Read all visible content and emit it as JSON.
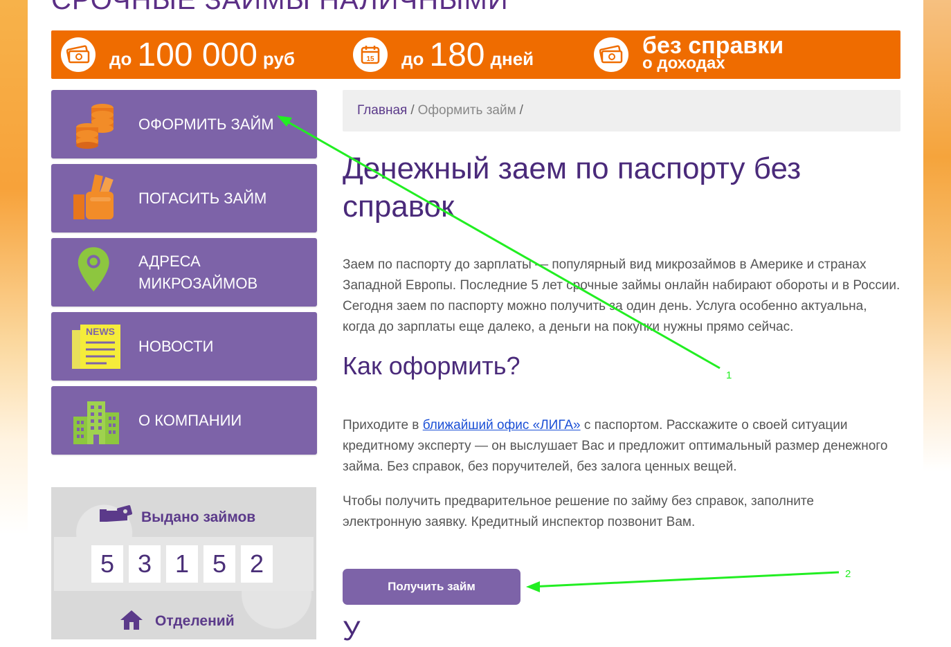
{
  "site": {
    "title": "СРОЧНЫЕ ЗАЙМЫ НАЛИЧНЫМИ"
  },
  "topbar": {
    "amount": {
      "icon": "money-icon",
      "pre": "до",
      "big": "100 000",
      "post": "руб"
    },
    "term": {
      "icon": "calendar-icon",
      "calendar_day": "15",
      "pre": "до",
      "big": "180",
      "post": "дней"
    },
    "nodocs": {
      "icon": "money-icon",
      "line1": "без справки",
      "line2": "о доходах"
    }
  },
  "menu": {
    "items": [
      {
        "label": "ОФОРМИТЬ ЗАЙМ",
        "icon": "coins-icon"
      },
      {
        "label": "ПОГАСИТЬ ЗАЙМ",
        "icon": "hand-money-icon"
      },
      {
        "label": "АДРЕСА МИКРОЗАЙМОВ",
        "icon": "map-pin-icon"
      },
      {
        "label": "НОВОСТИ",
        "icon": "news-icon",
        "icon_text": "NEWS"
      },
      {
        "label": "О КОМПАНИИ",
        "icon": "buildings-icon"
      }
    ]
  },
  "counter": {
    "title": "Выдано займов",
    "icon": "hand-cash-icon",
    "digits": [
      "5",
      "3",
      "1",
      "5",
      "2"
    ],
    "footer_title": "Отделений",
    "footer_icon": "house-icon"
  },
  "breadcrumb": {
    "home": "Главная",
    "sep1": "/",
    "current": "Оформить займ",
    "sep2": "/"
  },
  "article": {
    "title": "Денежный заем по паспорту без справок",
    "intro": "Заем по паспорту до зарплаты — популярный вид микрозаймов в Америке и странах Западной Европы. Последние 5 лет срочные займы онлайн набирают обороты и в России. Сегодня заем по паспорту можно получить за один день. Услуга особенно актуальна, когда до зарплаты еще далеко, а деньги на покупки нужны прямо сейчас.",
    "subtitle": "Как оформить?",
    "p2_before": "Приходите в ",
    "p2_link": "ближайший офис «ЛИГА»",
    "p2_after": " с паспортом. Расскажите о своей ситуации кредитному эксперту — он выслушает Вас и предложит оптимальный размер денежного займа. Без справок, без поручителей, без залога ценных вещей.",
    "p3": "Чтобы получить предварительное решение по займу без справок, заполните электронную заявку. Кредитный инспектор позвонит Вам.",
    "cta": "Получить займ",
    "next_heading_fragment": "У"
  },
  "annotations": {
    "arrow1_label": "1",
    "arrow2_label": "2",
    "color": "#22ee22"
  },
  "colors": {
    "accent_orange": "#ef6c00",
    "menu_purple": "#7d63a8",
    "heading_purple": "#4a2a7a",
    "link_blue": "#1a4fd6"
  }
}
